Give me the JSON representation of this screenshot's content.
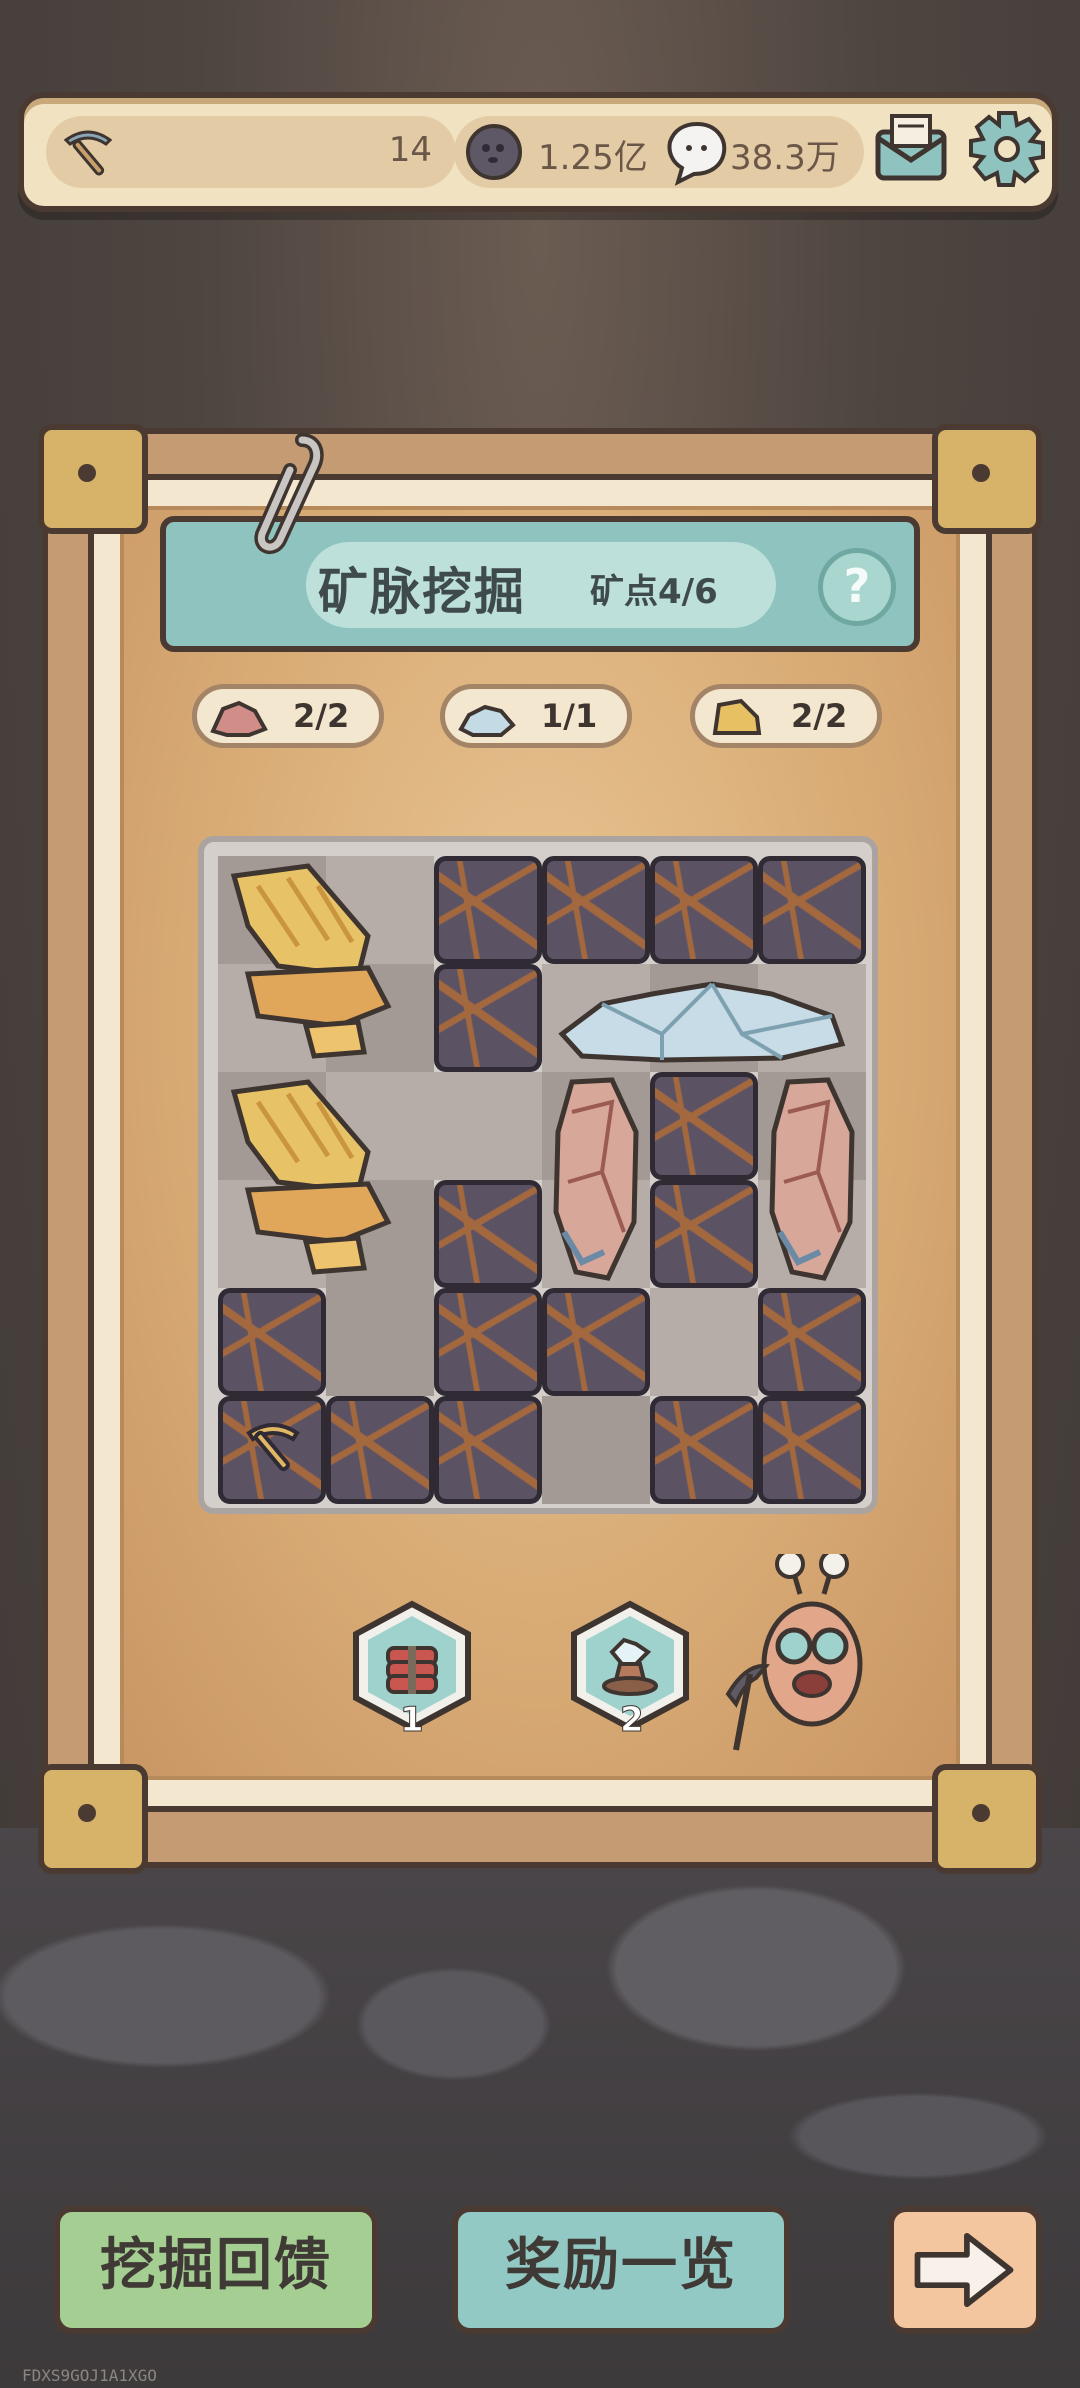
{
  "header": {
    "pickaxe_count": "14",
    "coins": "1.25亿",
    "gems": "38.3万"
  },
  "panel": {
    "title": "矿脉挖掘",
    "progress_label": "矿点4/6",
    "help_label": "?",
    "ore_counters": [
      {
        "icon": "red-ore-icon",
        "value": "2/2"
      },
      {
        "icon": "blue-ore-icon",
        "value": "1/1"
      },
      {
        "icon": "gold-ore-icon",
        "value": "2/2"
      }
    ]
  },
  "items": [
    {
      "icon": "dynamite-icon",
      "count": "1"
    },
    {
      "icon": "crystal-lamp-icon",
      "count": "2"
    }
  ],
  "buttons": {
    "feedback": "挖掘回馈",
    "rewards": "奖励一览",
    "next": "next-arrow-icon"
  },
  "watermark": "FDXS9GOJ1A1XGO",
  "colors": {
    "frame": "#4b3a31",
    "green_button": "#9fc98d",
    "teal_button": "#8fc3bf",
    "orange_button": "#f0a06a"
  }
}
